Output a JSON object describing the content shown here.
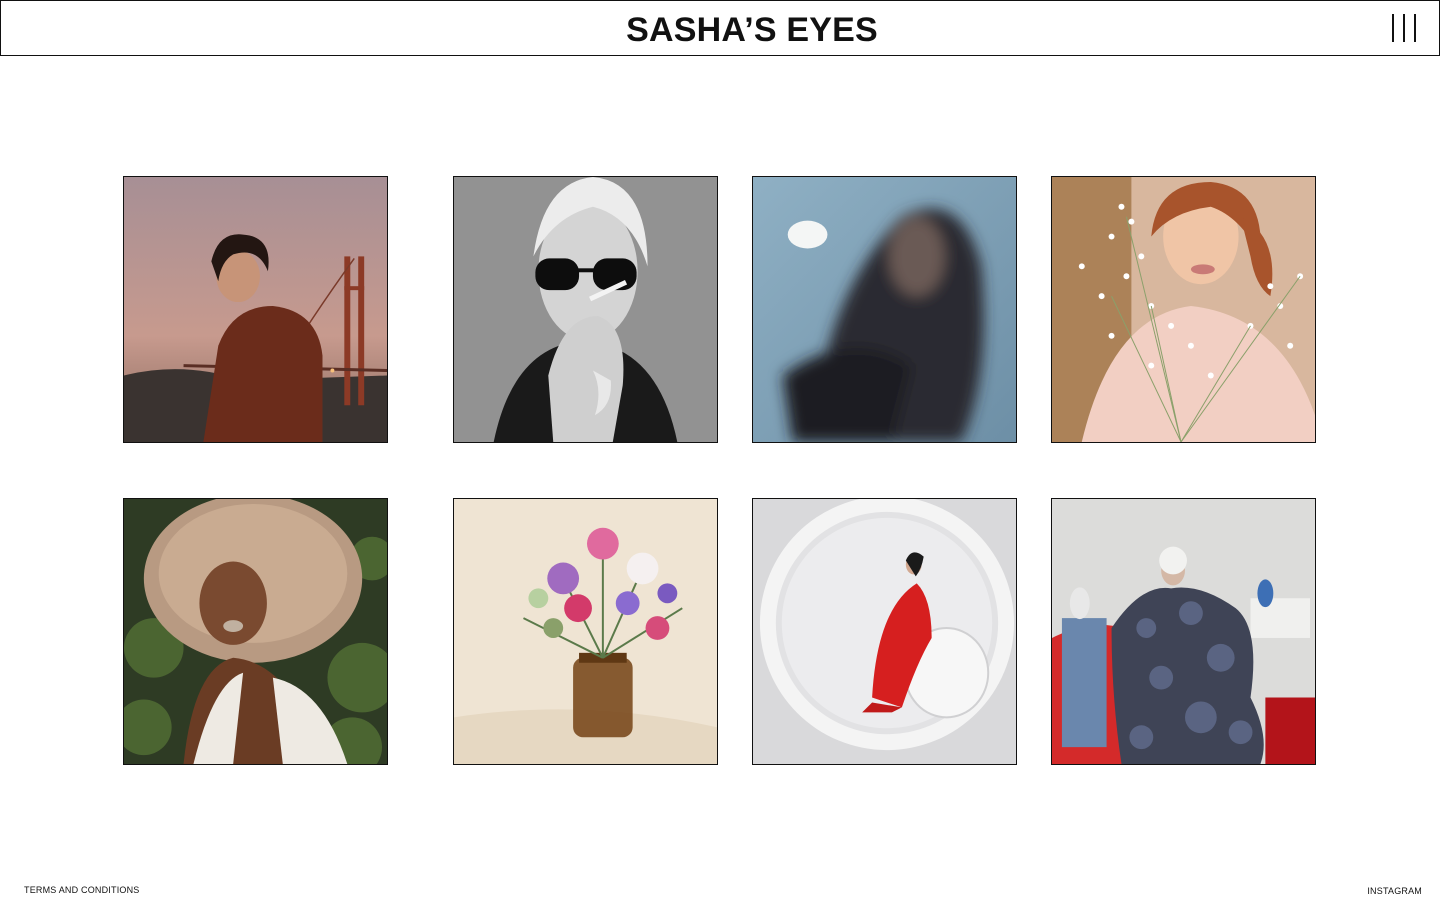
{
  "header": {
    "title": "SASHA’S EYES",
    "menu_icon": "hamburger-vertical-bars-icon"
  },
  "gallery": {
    "photos": [
      {
        "subject": "portrait-golden-gate-bridge"
      },
      {
        "subject": "portrait-sunglasses-cigarette-bw"
      },
      {
        "subject": "portrait-motion-blur-blue"
      },
      {
        "subject": "portrait-babys-breath-flowers"
      },
      {
        "subject": "portrait-curly-hair-foliage"
      },
      {
        "subject": "still-life-flower-bouquet-vase"
      },
      {
        "subject": "fashion-red-dress-white-circle"
      },
      {
        "subject": "fashion-polka-dot-dress-sculptures"
      }
    ]
  },
  "footer": {
    "terms_label": "TERMS AND CONDITIONS",
    "instagram_label": "INSTAGRAM"
  },
  "colors": {
    "border": "#111111",
    "background": "#ffffff",
    "text": "#111111"
  }
}
